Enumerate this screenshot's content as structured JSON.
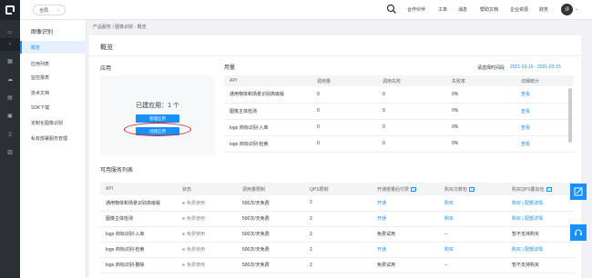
{
  "topbar": {
    "region": "全局",
    "nav": [
      "合作伙伴",
      "工单",
      "消息",
      "帮助文档",
      "企业资源",
      "财务"
    ],
    "avatar": "评"
  },
  "sidemenu": {
    "title": "图像识别",
    "items": [
      "概览",
      "应用列表",
      "监控报表",
      "技术文档",
      "SDK下载",
      "定制化图像识别",
      "私有部署服务管理"
    ]
  },
  "breadcrumb": "产品服务 / 图像识别 - 概览",
  "page": {
    "title": "概览",
    "app_section": "应用",
    "usage_section": "用量",
    "app_count_text": "已建应用：1 个",
    "manage_btn": "管理应用",
    "create_btn": "创建应用",
    "date_label": "请选择时间段",
    "date_range": "2021-03-15 - 2021-03-15",
    "services_section": "可用服务列表"
  },
  "usage_table": {
    "headers": [
      "API",
      "调用量",
      "调用失败",
      "失败率",
      "详细统计"
    ],
    "rows": [
      [
        "通用物体和场景识别高级版",
        "0",
        "0",
        "0%",
        "查看"
      ],
      [
        "图像主体检测",
        "0",
        "0",
        "0%",
        "查看"
      ],
      [
        "logo 商标识别-入库",
        "0",
        "0",
        "0%",
        "查看"
      ],
      [
        "logo 商标识别-检索",
        "0",
        "0",
        "0%",
        "查看"
      ]
    ]
  },
  "services_table": {
    "headers": [
      "API",
      "状态",
      "调用量限制",
      "QPS限制",
      "开通按量后付费",
      "购买次数包",
      "购买QPS叠加包"
    ],
    "rows": [
      [
        "通用物体和场景识别高级版",
        "免费使用",
        "500次/天免费",
        "2",
        "开通",
        "购买",
        "购买 | 配额详情"
      ],
      [
        "图像主体检测",
        "免费使用",
        "500次/天免费",
        "2",
        "开通",
        "购买",
        "购买 | 配额详情"
      ],
      [
        "logo 商标识别-入库",
        "免费使用",
        "500次/天免费",
        "2",
        "免费试用",
        "--",
        "暂不支持购买"
      ],
      [
        "logo 商标识别-检索",
        "免费使用",
        "500次/天免费",
        "2",
        "开通",
        "购买",
        "购买 | 配额详情"
      ],
      [
        "logo 商标识别-删除",
        "免费使用",
        "500次/天免费",
        "2",
        "免费试用",
        "--",
        "暂不支持购买"
      ]
    ]
  },
  "colors": {
    "accent": "#1890ff",
    "highlight": "#d0201f",
    "rail": "#2b2f36"
  },
  "icons": [
    "logo-icon",
    "search-icon",
    "expand-icon",
    "edit-icon",
    "headset-icon"
  ]
}
